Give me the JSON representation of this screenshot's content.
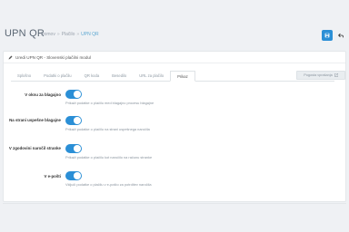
{
  "header": {
    "title": "UPN QR",
    "breadcrumb": [
      "Domov",
      "Plačilo",
      "UPN QR"
    ]
  },
  "panel": {
    "heading": "Uredi UPN QR - Slovenski plačilni modul"
  },
  "tabs": [
    {
      "label": "Splošno",
      "active": false
    },
    {
      "label": "Podatki o plačilu",
      "active": false
    },
    {
      "label": "QR koda",
      "active": false
    },
    {
      "label": "Besedilo",
      "active": false
    },
    {
      "label": "URL za plačilo",
      "active": false
    },
    {
      "label": "Prikaz",
      "active": true
    }
  ],
  "help_button": {
    "label": "Pogosta vprašanja"
  },
  "settings": [
    {
      "label": "V oknu za blagajno",
      "enabled": true,
      "help": "Prikaži podatke o plačilu med blagajno procesu blagajne"
    },
    {
      "label": "Na strani uspešne blagajne",
      "enabled": true,
      "help": "Prikaži podatke o plačilu na strani uspešnega naročila"
    },
    {
      "label": "V zgodovini naročil stranke",
      "enabled": true,
      "help": "Prikaži podatke o plačilu kot naročilo na računu stranke"
    },
    {
      "label": "V e-pošti",
      "enabled": true,
      "help": "Vključi podatke o plačilu v e-pošto za potrditev naročila"
    }
  ],
  "colors": {
    "accent": "#2b8fd6",
    "background": "#eff1f4",
    "panel": "#ffffff"
  }
}
